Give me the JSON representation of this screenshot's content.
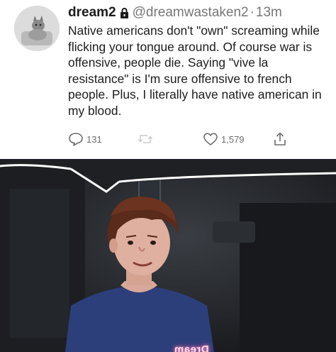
{
  "tweet": {
    "display_name": "dream2",
    "handle": "@dreamwastaken2",
    "separator": "·",
    "time": "13m",
    "text": "Native americans don't \"own\" screaming while flicking your tongue around. Of course war is offensive, people die. Saying \"vive la resistance\" is I'm sure offensive to french people. Plus, I literally have native american in my blood.",
    "replies": "131",
    "likes": "1,579",
    "icons": [
      "lock-icon",
      "reply-icon",
      "retweet-icon",
      "like-icon",
      "share-icon"
    ]
  },
  "stream_frame": {
    "neon_sign": "Dream"
  },
  "colors": {
    "text": "#1d1d1d",
    "muted": "#777777",
    "background_tweet": "#ffffff",
    "background_stream": "#1f2226",
    "neon_pink": "#ff9ec6"
  }
}
